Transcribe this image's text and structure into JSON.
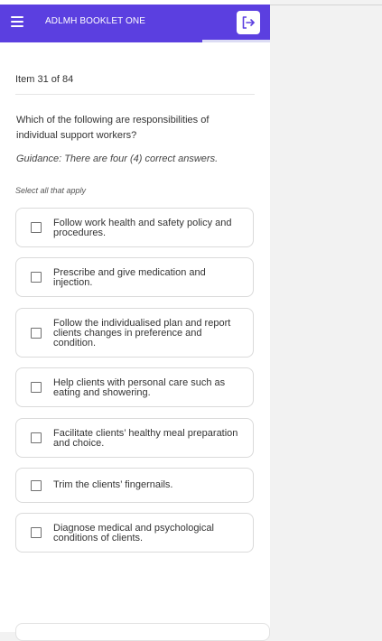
{
  "header": {
    "title": "ADLMH BOOKLET ONE",
    "menu_icon": "hamburger-menu-icon",
    "exit_icon": "exit-icon",
    "accent_color": "#5b3fe0",
    "progress_fraction": 0.75
  },
  "question": {
    "counter": "Item 31 of 84",
    "text": "Which of the following are responsibilities of individual support workers?",
    "guidance": "Guidance: There are four (4) correct answers.",
    "instruction": "Select all that apply"
  },
  "options": [
    {
      "label": "Follow work health and safety policy and procedures.",
      "checked": false
    },
    {
      "label": "Prescribe and give medication and injection.",
      "checked": false
    },
    {
      "label": "Follow the individualised plan and report clients changes in preference and condition.",
      "checked": false
    },
    {
      "label": "Help clients with personal care such as eating and showering.",
      "checked": false
    },
    {
      "label": "Facilitate clients’ healthy meal preparation and choice.",
      "checked": false
    },
    {
      "label": "Trim the clients’ fingernails.",
      "checked": false
    },
    {
      "label": "Diagnose medical and psychological conditions of clients.",
      "checked": false
    }
  ]
}
